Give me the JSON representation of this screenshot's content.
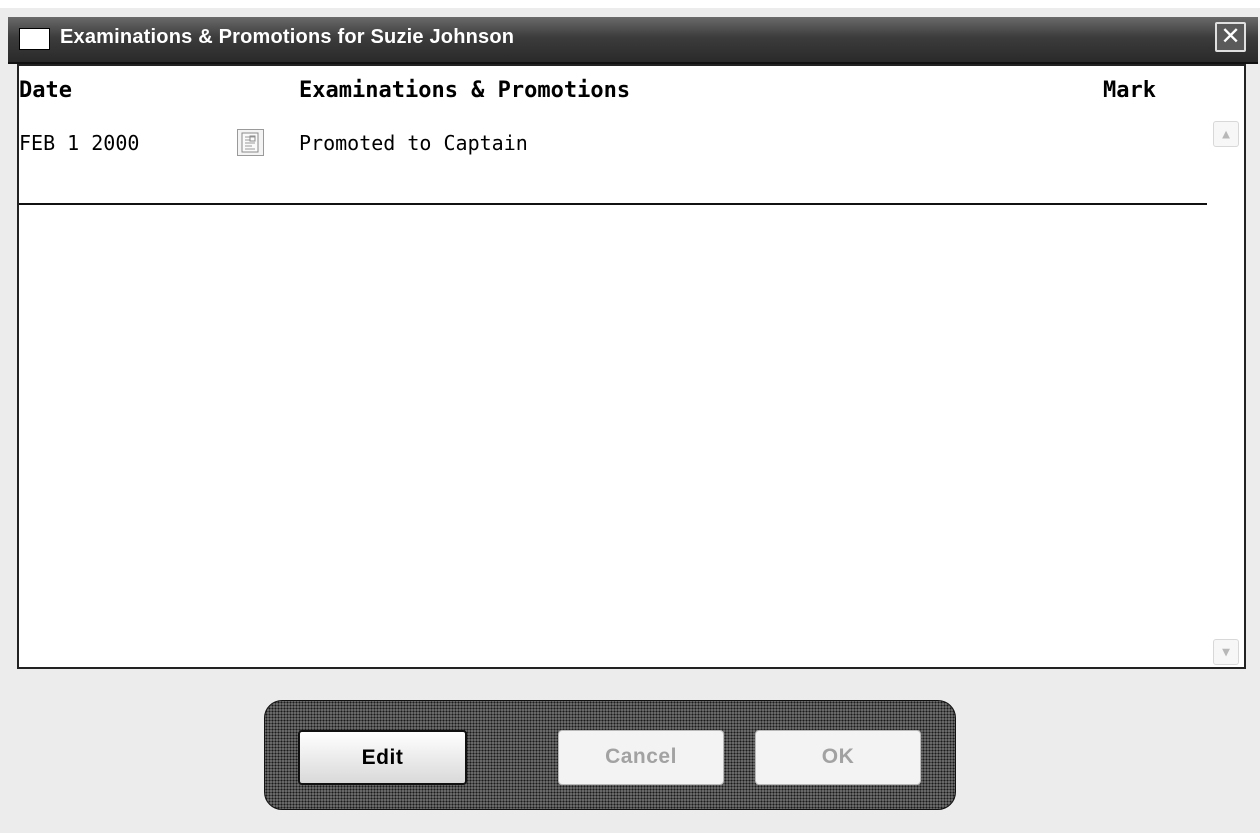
{
  "window": {
    "title": "Examinations & Promotions for Suzie Johnson",
    "close_glyph": "✕",
    "close_icon": "close-icon"
  },
  "table": {
    "headers": {
      "date": "Date",
      "exam": "Examinations & Promotions",
      "mark": "Mark"
    },
    "rows": [
      {
        "date": "FEB 1 2000",
        "icon": "document-icon",
        "description": "Promoted to Captain",
        "mark": ""
      }
    ]
  },
  "buttons": {
    "edit": {
      "label": "Edit",
      "enabled": true
    },
    "cancel": {
      "label": "Cancel",
      "enabled": false
    },
    "ok": {
      "label": "OK",
      "enabled": false
    }
  },
  "scrollbar": {
    "up_icon": "scroll-up-icon",
    "down_icon": "scroll-down-icon"
  }
}
